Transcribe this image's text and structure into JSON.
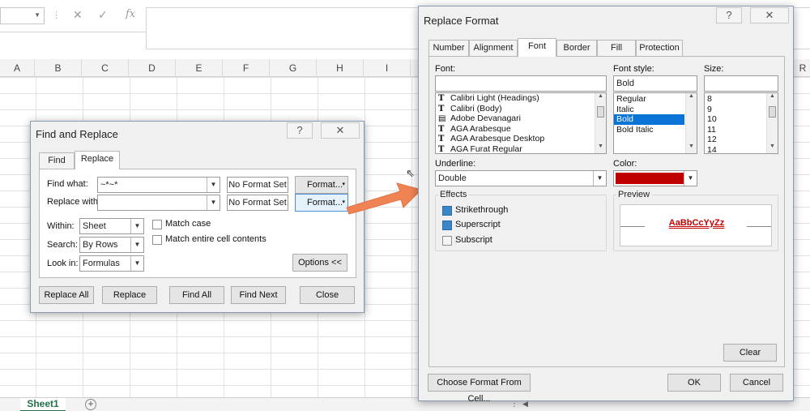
{
  "excel": {
    "columns": [
      "A",
      "B",
      "C",
      "D",
      "E",
      "F",
      "G",
      "H",
      "I",
      "R"
    ],
    "sheet_tab": "Sheet1",
    "add_sheet": "+",
    "fx": "fx"
  },
  "find_replace": {
    "title": "Find and Replace",
    "help": "?",
    "close_x": "✕",
    "tabs": [
      "Find",
      "Replace"
    ],
    "find_what_label": "Find what:",
    "find_what_value": "~*~*",
    "replace_with_label": "Replace with:",
    "replace_with_value": "",
    "no_format_1": "No Format Set",
    "no_format_2": "No Format Set",
    "format_btn_1": "Format...",
    "format_btn_2": "Format...",
    "within_label": "Within:",
    "within_value": "Sheet",
    "search_label": "Search:",
    "search_value": "By Rows",
    "lookin_label": "Look in:",
    "lookin_value": "Formulas",
    "match_case": "Match case",
    "match_entire": "Match entire cell contents",
    "options_btn": "Options <<",
    "buttons": {
      "replace_all": "Replace All",
      "replace": "Replace",
      "find_all": "Find All",
      "find_next": "Find Next",
      "close": "Close"
    }
  },
  "replace_format": {
    "title": "Replace Format",
    "help": "?",
    "close_x": "✕",
    "tabs": [
      "Number",
      "Alignment",
      "Font",
      "Border",
      "Fill",
      "Protection"
    ],
    "font_label": "Font:",
    "font_value": "",
    "fonts": [
      "Calibri Light (Headings)",
      "Calibri (Body)",
      "Adobe Devanagari",
      "AGA Arabesque",
      "AGA Arabesque Desktop",
      "AGA Furat Regular"
    ],
    "font_style_label": "Font style:",
    "font_style_value": "Bold",
    "styles": [
      "Regular",
      "Italic",
      "Bold",
      "Bold Italic"
    ],
    "size_label": "Size:",
    "size_value": "",
    "sizes": [
      "8",
      "9",
      "10",
      "11",
      "12",
      "14"
    ],
    "underline_label": "Underline:",
    "underline_value": "Double",
    "color_label": "Color:",
    "color_value": "#c00000",
    "effects_label": "Effects",
    "strikethrough": "Strikethrough",
    "superscript": "Superscript",
    "subscript": "Subscript",
    "preview_label": "Preview",
    "preview_text": "AaBbCcYyZz",
    "clear_btn": "Clear",
    "choose_btn": "Choose Format From Cell...",
    "ok_btn": "OK",
    "cancel_btn": "Cancel"
  },
  "colors": {
    "arrow": "#ef8354",
    "accent": "#0a73d6",
    "excel_green": "#217346"
  }
}
